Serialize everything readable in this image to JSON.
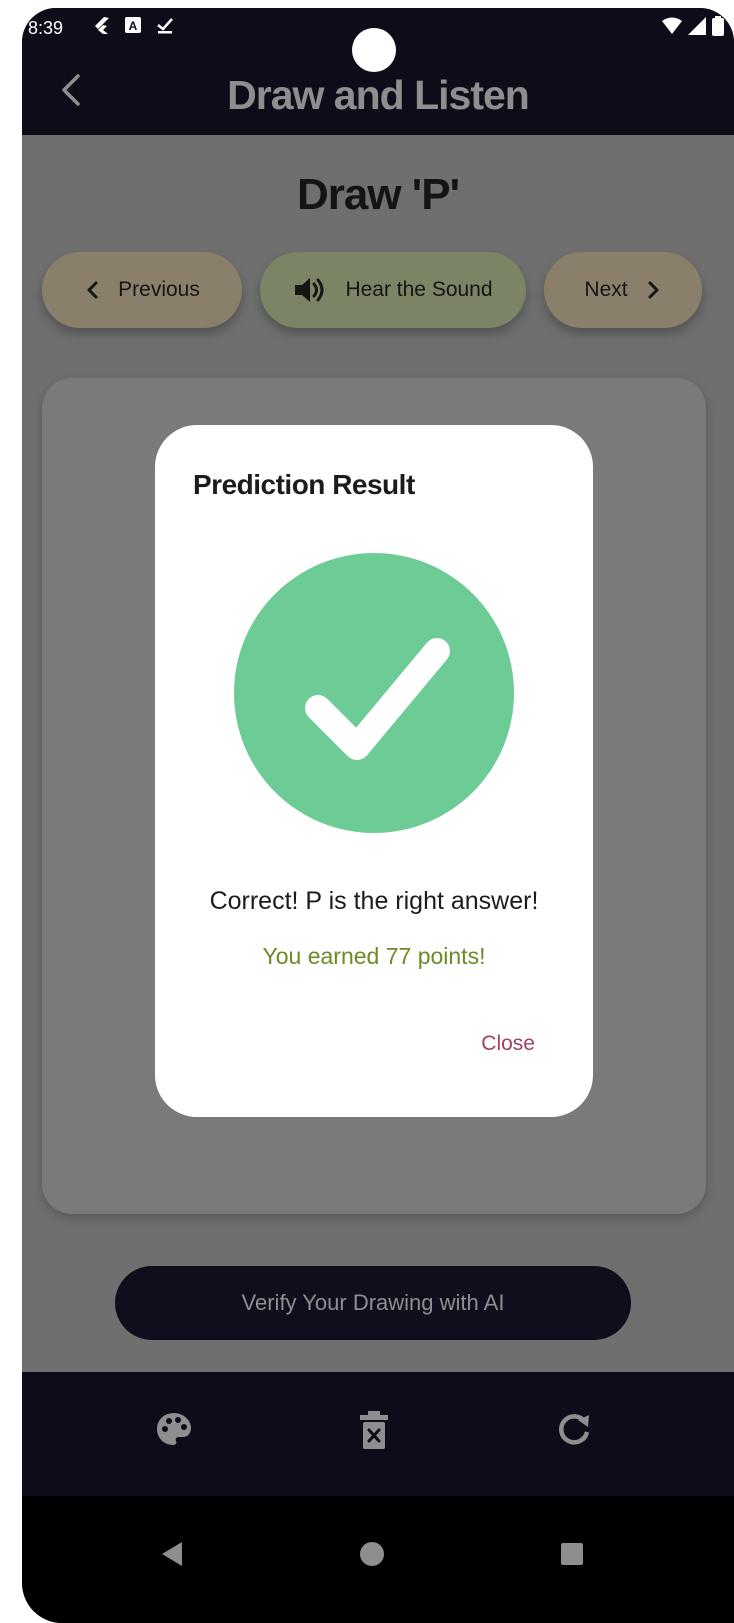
{
  "status_bar": {
    "time": "8:39"
  },
  "app_bar": {
    "title": "Draw and Listen"
  },
  "main": {
    "heading": "Draw 'P'",
    "previous_label": "Previous",
    "sound_label": "Hear the Sound",
    "next_label": "Next",
    "verify_label": "Verify Your Drawing with AI"
  },
  "dialog": {
    "title": "Prediction Result",
    "result": "Correct! P is the right answer!",
    "points": "You earned 77 points!",
    "close_label": "Close"
  },
  "toolbar": {
    "icons": [
      "palette-icon",
      "delete-icon",
      "refresh-icon"
    ]
  },
  "colors": {
    "app_bar_bg": "#0d0c18",
    "success_green": "#6dcb95",
    "points_text": "#6e8a26",
    "close_text": "#a0435e"
  }
}
